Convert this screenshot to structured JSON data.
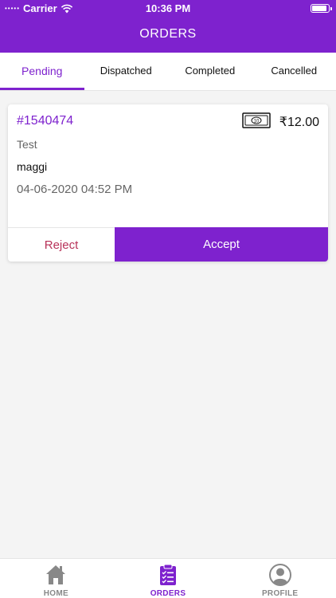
{
  "status_bar": {
    "carrier": "Carrier",
    "time": "10:36 PM",
    "battery_level": 0.9
  },
  "header": {
    "title": "ORDERS"
  },
  "tabs": [
    {
      "label": "Pending",
      "active": true
    },
    {
      "label": "Dispatched",
      "active": false
    },
    {
      "label": "Completed",
      "active": false
    },
    {
      "label": "Cancelled",
      "active": false
    }
  ],
  "order": {
    "id": "#1540474",
    "payment_icon": "cash-note-icon",
    "cash_note_value": "10",
    "amount": "₹12.00",
    "customer": "Test",
    "item": "maggi",
    "datetime": "04-06-2020 04:52 PM",
    "reject_label": "Reject",
    "accept_label": "Accept"
  },
  "bottom_nav": [
    {
      "label": "HOME",
      "icon": "home-icon",
      "active": false
    },
    {
      "label": "ORDERS",
      "icon": "clipboard-list-icon",
      "active": true
    },
    {
      "label": "PROFILE",
      "icon": "user-circle-icon",
      "active": false
    }
  ],
  "colors": {
    "accent": "#7e22ce",
    "reject": "#b8335a",
    "background": "#f4f4f4",
    "inactive": "#888888"
  }
}
